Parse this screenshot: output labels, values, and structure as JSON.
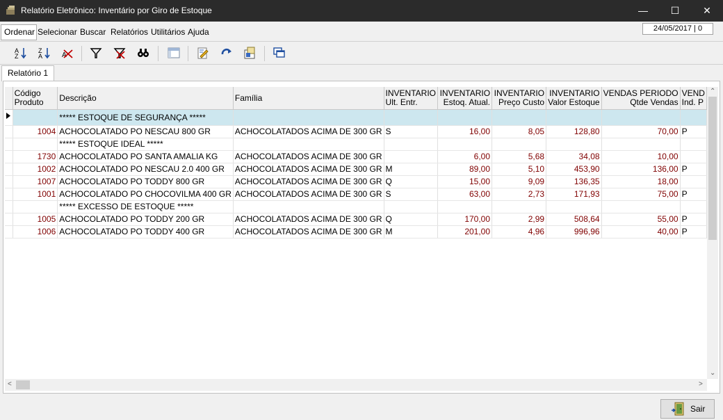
{
  "window": {
    "title": "Relatório Eletrônico: Inventário por Giro de Estoque"
  },
  "menu": [
    "Ordenar",
    "Selecionar",
    "Buscar",
    "Relatórios",
    "Utilitários",
    "Ajuda"
  ],
  "date_info": "24/05/2017 | 0",
  "tabs": [
    "Relatório 1"
  ],
  "columns": [
    {
      "l1": "Código",
      "l2": "Produto"
    },
    {
      "l1": "Descrição",
      "l2": ""
    },
    {
      "l1": "Família",
      "l2": ""
    },
    {
      "l1": "INVENTARIO",
      "l2": "Ult. Entr."
    },
    {
      "l1": "INVENTARIO",
      "l2": "Estoq. Atual."
    },
    {
      "l1": "INVENTARIO",
      "l2": "Preço Custo"
    },
    {
      "l1": "INVENTARIO",
      "l2": "Valor Estoque"
    },
    {
      "l1": "VENDAS PERIODO",
      "l2": "Qtde Vendas"
    },
    {
      "l1": "VEND",
      "l2": "Ind. P"
    }
  ],
  "rows": [
    {
      "code": "",
      "desc": "***** ESTOQUE DE SEGURANÇA *****",
      "fam": "",
      "ult": "",
      "estoq": "",
      "preco": "",
      "valor": "",
      "vendas": "",
      "ind": "",
      "selected": true
    },
    {
      "code": "1004",
      "desc": "ACHOCOLATADO PO NESCAU 800 GR",
      "fam": "ACHOCOLATADOS ACIMA DE 300 GR",
      "ult": "S",
      "estoq": "16,00",
      "preco": "8,05",
      "valor": "128,80",
      "vendas": "70,00",
      "ind": "P"
    },
    {
      "code": "",
      "desc": "***** ESTOQUE IDEAL *****",
      "fam": "",
      "ult": "",
      "estoq": "",
      "preco": "",
      "valor": "",
      "vendas": "",
      "ind": ""
    },
    {
      "code": "1730",
      "desc": "ACHOCOLATADO PO SANTA AMALIA KG",
      "fam": "ACHOCOLATADOS ACIMA DE 300 GR",
      "ult": "",
      "estoq": "6,00",
      "preco": "5,68",
      "valor": "34,08",
      "vendas": "10,00",
      "ind": ""
    },
    {
      "code": "1002",
      "desc": "ACHOCOLATADO PO NESCAU 2.0 400 GR",
      "fam": "ACHOCOLATADOS ACIMA DE 300 GR",
      "ult": "M",
      "estoq": "89,00",
      "preco": "5,10",
      "valor": "453,90",
      "vendas": "136,00",
      "ind": "P"
    },
    {
      "code": "1007",
      "desc": "ACHOCOLATADO PO TODDY 800 GR",
      "fam": "ACHOCOLATADOS ACIMA DE 300 GR",
      "ult": "Q",
      "estoq": "15,00",
      "preco": "9,09",
      "valor": "136,35",
      "vendas": "18,00",
      "ind": ""
    },
    {
      "code": "1001",
      "desc": "ACHOCOLATADO PO CHOCOVILMA 400 GR",
      "fam": "ACHOCOLATADOS ACIMA DE 300 GR",
      "ult": "S",
      "estoq": "63,00",
      "preco": "2,73",
      "valor": "171,93",
      "vendas": "75,00",
      "ind": "P"
    },
    {
      "code": "",
      "desc": "***** EXCESSO DE ESTOQUE *****",
      "fam": "",
      "ult": "",
      "estoq": "",
      "preco": "",
      "valor": "",
      "vendas": "",
      "ind": ""
    },
    {
      "code": "1005",
      "desc": "ACHOCOLATADO PO TODDY 200 GR",
      "fam": "ACHOCOLATADOS ACIMA DE 300 GR",
      "ult": "Q",
      "estoq": "170,00",
      "preco": "2,99",
      "valor": "508,64",
      "vendas": "55,00",
      "ind": "P"
    },
    {
      "code": "1006",
      "desc": "ACHOCOLATADO PO TODDY 400 GR",
      "fam": "ACHOCOLATADOS ACIMA DE 300 GR",
      "ult": "M",
      "estoq": "201,00",
      "preco": "4,96",
      "valor": "996,96",
      "vendas": "40,00",
      "ind": "P"
    }
  ],
  "footer": {
    "exit_label": "Sair"
  },
  "icons": [
    "sort-asc-icon",
    "sort-desc-icon",
    "clear-sort-icon",
    "filter-icon",
    "clear-filter-icon",
    "find-icon",
    "layout-icon",
    "edit-icon",
    "refresh-icon",
    "export-icon",
    "windows-icon",
    "door-icon"
  ]
}
